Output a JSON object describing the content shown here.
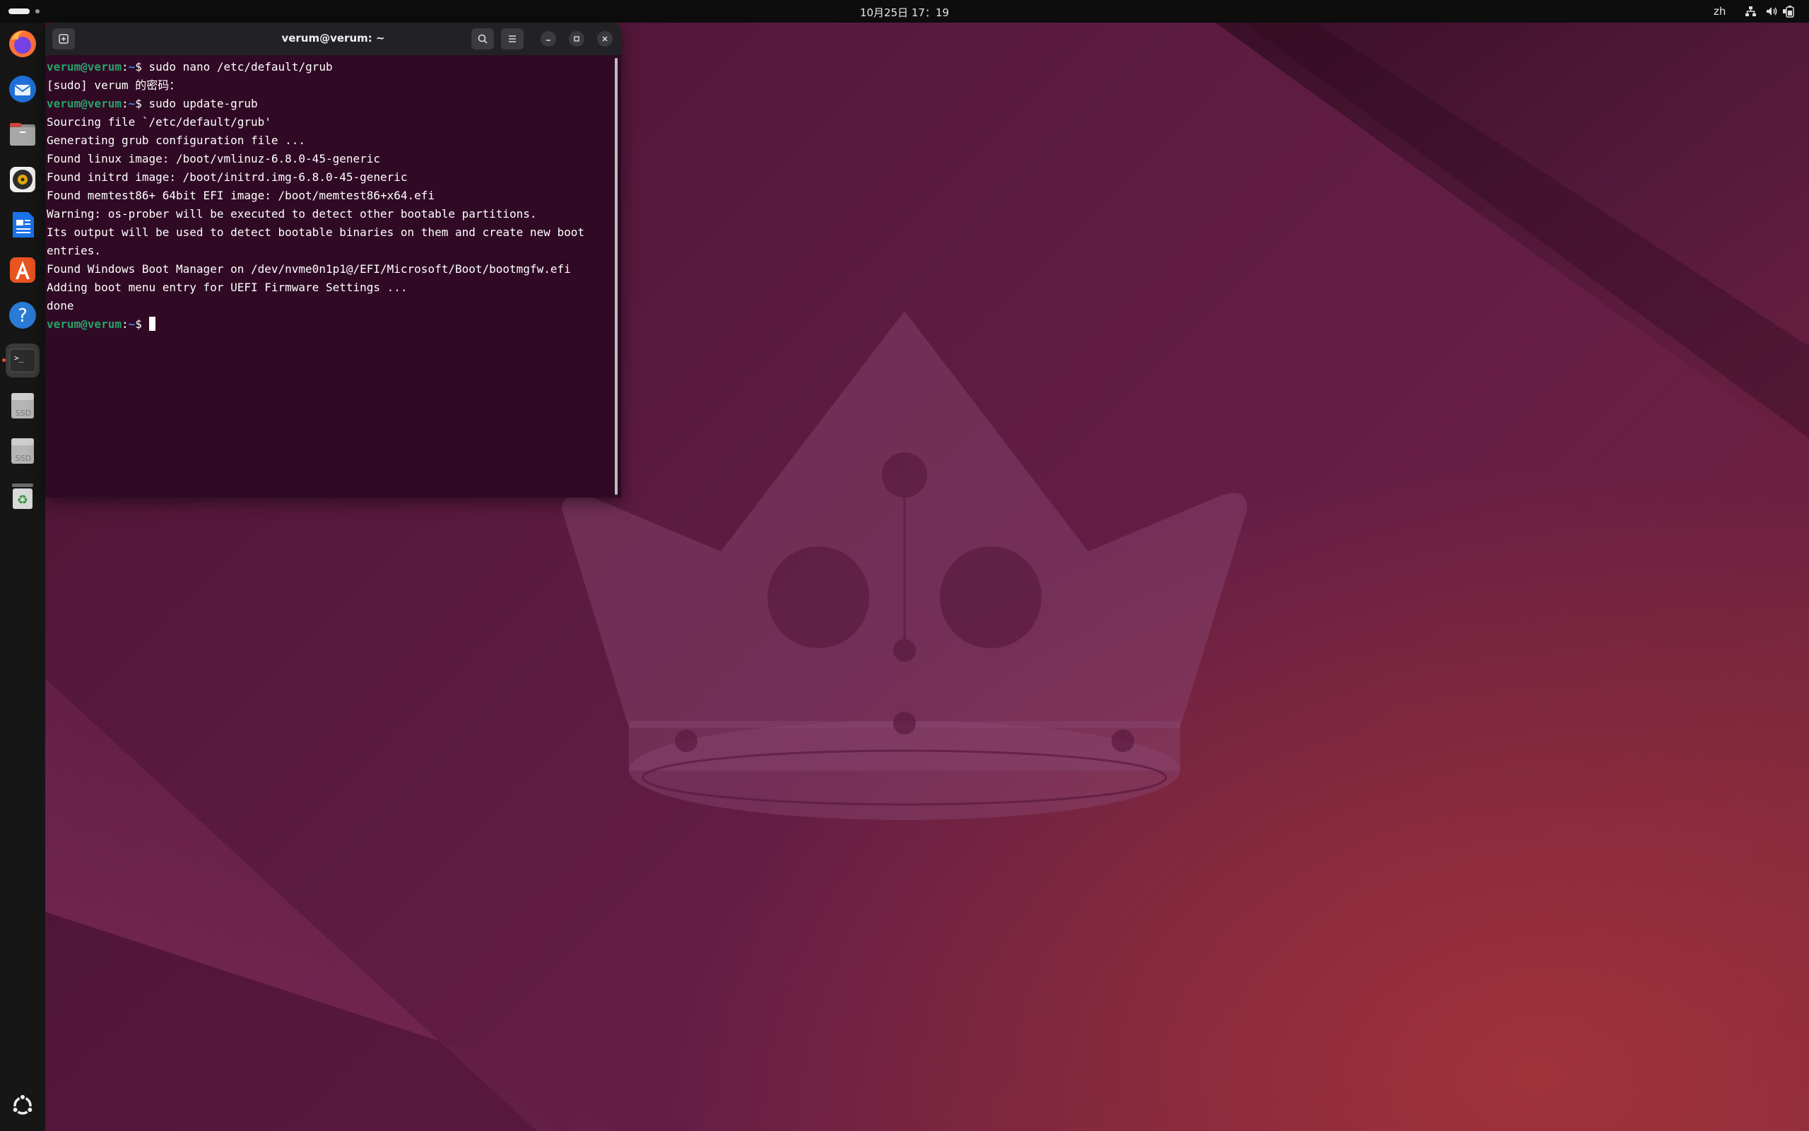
{
  "topbar": {
    "clock": "10月25日 17：19",
    "lang": "zh",
    "tray": [
      "network-icon",
      "volume-icon",
      "battery-icon"
    ]
  },
  "dock": {
    "items": [
      {
        "name": "firefox",
        "icon": "firefox-icon"
      },
      {
        "name": "thunderbird",
        "icon": "thunderbird-icon"
      },
      {
        "name": "files",
        "icon": "files-icon"
      },
      {
        "name": "rhythmbox",
        "icon": "rhythmbox-icon"
      },
      {
        "name": "writer",
        "icon": "writer-icon"
      },
      {
        "name": "app-center",
        "icon": "app-center-icon"
      },
      {
        "name": "help",
        "icon": "help-icon",
        "label": "?"
      },
      {
        "name": "terminal",
        "icon": "terminal-icon",
        "label": ">_"
      },
      {
        "name": "ssd-1",
        "icon": "drive-icon",
        "label": "SSD"
      },
      {
        "name": "ssd-2",
        "icon": "drive-icon",
        "label": "SSD"
      },
      {
        "name": "trash",
        "icon": "trash-icon",
        "label": "♻"
      }
    ],
    "show_apps_icon": "show-apps-icon"
  },
  "terminal": {
    "title": "verum@verum: ~",
    "prompt_user": "verum@verum",
    "prompt_sep": ":",
    "prompt_path": "~",
    "prompt_end": "$ ",
    "lines": [
      {
        "type": "cmd",
        "text": "sudo nano /etc/default/grub"
      },
      {
        "type": "out",
        "text": "[sudo] verum 的密码："
      },
      {
        "type": "cmd",
        "text": "sudo update-grub"
      },
      {
        "type": "out",
        "text": "Sourcing file `/etc/default/grub'"
      },
      {
        "type": "out",
        "text": "Generating grub configuration file ..."
      },
      {
        "type": "out",
        "text": "Found linux image: /boot/vmlinuz-6.8.0-45-generic"
      },
      {
        "type": "out",
        "text": "Found initrd image: /boot/initrd.img-6.8.0-45-generic"
      },
      {
        "type": "out",
        "text": "Found memtest86+ 64bit EFI image: /boot/memtest86+x64.efi"
      },
      {
        "type": "out",
        "text": "Warning: os-prober will be executed to detect other bootable partitions."
      },
      {
        "type": "out",
        "text": "Its output will be used to detect bootable binaries on them and create new boot"
      },
      {
        "type": "out",
        "text": "entries."
      },
      {
        "type": "out",
        "text": "Found Windows Boot Manager on /dev/nvme0n1p1@/EFI/Microsoft/Boot/bootmgfw.efi"
      },
      {
        "type": "out",
        "text": "Adding boot menu entry for UEFI Firmware Settings ..."
      },
      {
        "type": "out",
        "text": "done"
      },
      {
        "type": "cmd",
        "text": ""
      }
    ]
  }
}
